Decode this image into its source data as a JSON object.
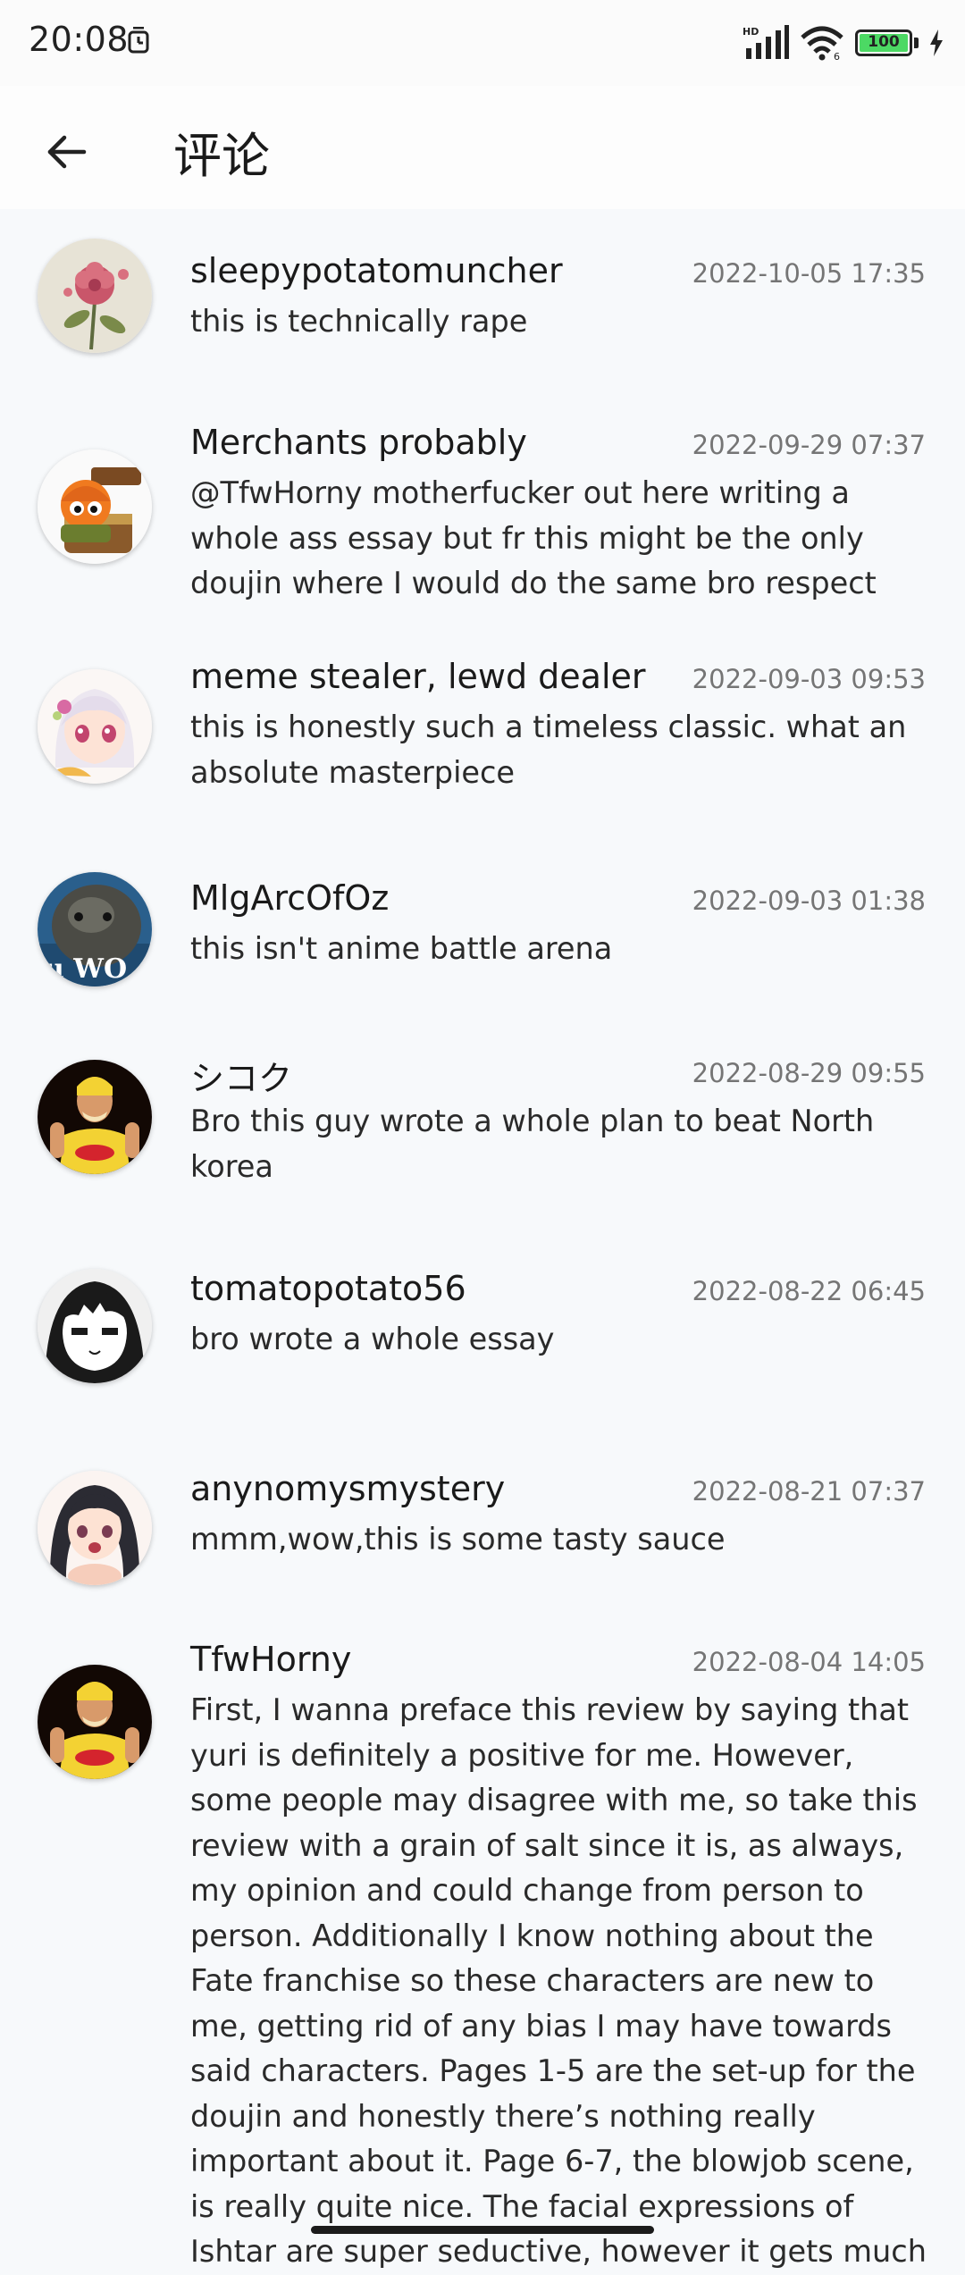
{
  "status_bar": {
    "time": "20:08",
    "battery": "100",
    "network_label": "HD",
    "icons": [
      "alarm-icon",
      "signal-icon",
      "wifi-icon",
      "battery-icon",
      "charging-icon"
    ]
  },
  "header": {
    "title": "评论",
    "back_icon": "arrow-left-icon"
  },
  "comments": [
    {
      "user": "sleepypotatomuncher",
      "date": "2022-10-05 17:35",
      "text": "this is technically rape"
    },
    {
      "user": "Merchants probably",
      "date": "2022-09-29 07:37",
      "text": "@TfwHorny motherfucker out here writing a whole ass essay but fr this might be the only doujin where I would do the same bro respect"
    },
    {
      "user": "meme stealer, lewd dealer",
      "date": "2022-09-03 09:53",
      "text": "this is honestly such a timeless classic. what an absolute masterpiece"
    },
    {
      "user": "MlgArcOfOz",
      "date": "2022-09-03 01:38",
      "text": "this isn't anime battle arena"
    },
    {
      "user": "シコク",
      "date": "2022-08-29 09:55",
      "text": "Bro this guy wrote a whole plan to beat North korea"
    },
    {
      "user": "tomatopotato56",
      "date": "2022-08-22 06:45",
      "text": "bro wrote a whole essay"
    },
    {
      "user": "anynomysmystery",
      "date": "2022-08-21 07:37",
      "text": "mmm,wow,this is some tasty sauce"
    },
    {
      "user": "TfwHorny",
      "date": "2022-08-04 14:05",
      "text": "First, I wanna preface this review by saying that yuri is definitely a positive for me. However, some people may disagree with me, so take this review with a grain of salt since it is, as always, my opinion and could change from person to person. Additionally I know nothing about the Fate franchise so these characters are new to me, getting rid of any bias I may have towards said characters. Pages 1-5 are the set-up for the doujin and honestly there’s nothing really important about it. Page 6-7, the blowjob scene, is really quite nice. The facial expressions of Ishtar are super seductive, however it gets much"
    }
  ]
}
